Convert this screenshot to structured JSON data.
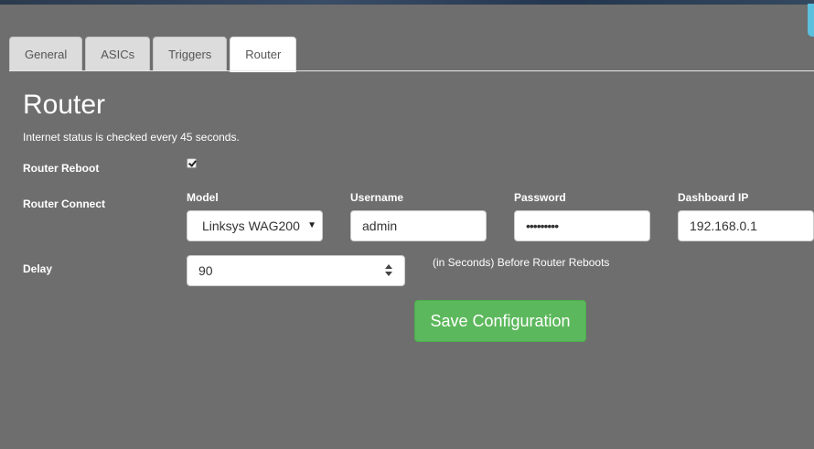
{
  "colors": {
    "background": "#6e6e6e",
    "accent_green": "#5cb85c",
    "tab_active": "#ffffff",
    "tab_inactive": "#dcdcdc"
  },
  "tabs": [
    {
      "label": "General",
      "active": false
    },
    {
      "label": "ASICs",
      "active": false
    },
    {
      "label": "Triggers",
      "active": false
    },
    {
      "label": "Router",
      "active": true
    }
  ],
  "page": {
    "title": "Router",
    "subtitle": "Internet status is checked every 45 seconds."
  },
  "router_reboot": {
    "label": "Router Reboot",
    "checked": true,
    "icon": "checkbox-checked"
  },
  "router_connect": {
    "label": "Router Connect",
    "model": {
      "label": "Model",
      "value": "Linksys WAG200",
      "icon": "caret-down"
    },
    "username": {
      "label": "Username",
      "value": "admin"
    },
    "password": {
      "label": "Password",
      "value": "•••••••••"
    },
    "dashboard_ip": {
      "label": "Dashboard IP",
      "value": "192.168.0.1"
    }
  },
  "delay": {
    "label": "Delay",
    "value": "90",
    "hint": "(in Seconds) Before Router Reboots",
    "icon": "spinner-arrows"
  },
  "save_button": {
    "label": "Save Configuration"
  }
}
